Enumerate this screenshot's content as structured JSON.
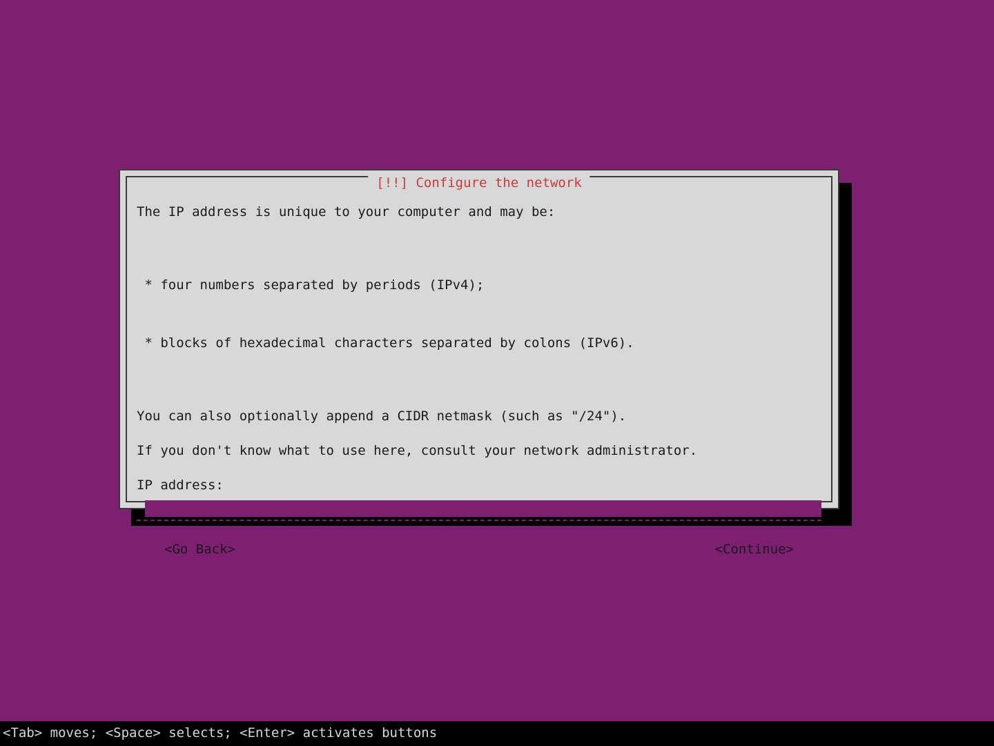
{
  "dialog": {
    "title": "[!!] Configure the network",
    "body": {
      "intro": "The IP address is unique to your computer and may be:",
      "bullet1": " * four numbers separated by periods (IPv4);",
      "bullet2": " * blocks of hexadecimal characters separated by colons (IPv6).",
      "cidr": "You can also optionally append a CIDR netmask (such as \"/24\").",
      "consult": "If you don't know what to use here, consult your network administrator.",
      "field_label": "IP address:",
      "field_value": ""
    },
    "buttons": {
      "back": "<Go Back>",
      "continue": "<Continue>"
    }
  },
  "statusbar": "<Tab> moves; <Space> selects; <Enter> activates buttons"
}
